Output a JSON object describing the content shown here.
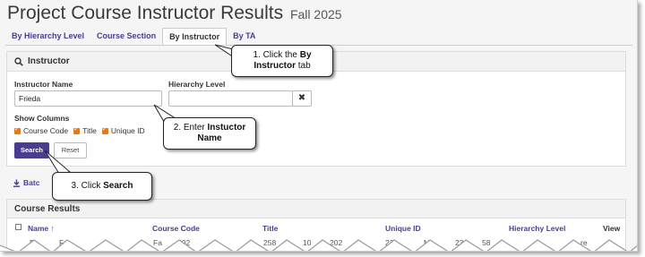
{
  "header": {
    "title": "Project Course Instructor Results",
    "subtitle": "Fall 2025"
  },
  "tabs": [
    {
      "label": "By Hierarchy Level"
    },
    {
      "label": "Course Section"
    },
    {
      "label": "By Instructor",
      "active": true
    },
    {
      "label": "By TA"
    }
  ],
  "instructor_panel": {
    "title": "Instructor",
    "instructor_name_label": "Instructor Name",
    "instructor_name_value": "Frieda",
    "hierarchy_level_label": "Hierarchy Level",
    "hierarchy_level_value": "",
    "show_columns_label": "Show Columns",
    "columns": [
      {
        "label": "Course Code",
        "checked": true
      },
      {
        "label": "Title",
        "checked": true
      },
      {
        "label": "Unique ID",
        "checked": true
      }
    ],
    "search_button": "Search",
    "reset_button": "Reset"
  },
  "batch_link": "Batc",
  "results": {
    "title": "Course Results",
    "columns": [
      "Name ↑",
      "Course Code",
      "Title",
      "Unique ID",
      "Hierarchy Level",
      "View"
    ],
    "partial_row": [
      "Fa",
      "Fri",
      "Fa",
      "202",
      "258",
      "10",
      "202",
      "23",
      "M",
      "23",
      "58",
      "re"
    ]
  },
  "callouts": [
    {
      "prefix": "1. Click the ",
      "bold": "By Instructor",
      "suffix": " tab"
    },
    {
      "prefix": "2. Enter ",
      "bold": "Instuctor Name",
      "suffix": ""
    },
    {
      "prefix": "3. Click ",
      "bold": "Search",
      "suffix": ""
    }
  ],
  "colors": {
    "accent": "#4a3d8f",
    "checkbox": "#e07b1c",
    "panel_header": "#f2f2f2"
  },
  "icons": [
    "search-icon",
    "close-icon",
    "download-icon",
    "sort-up-icon",
    "checkbox-icon"
  ]
}
